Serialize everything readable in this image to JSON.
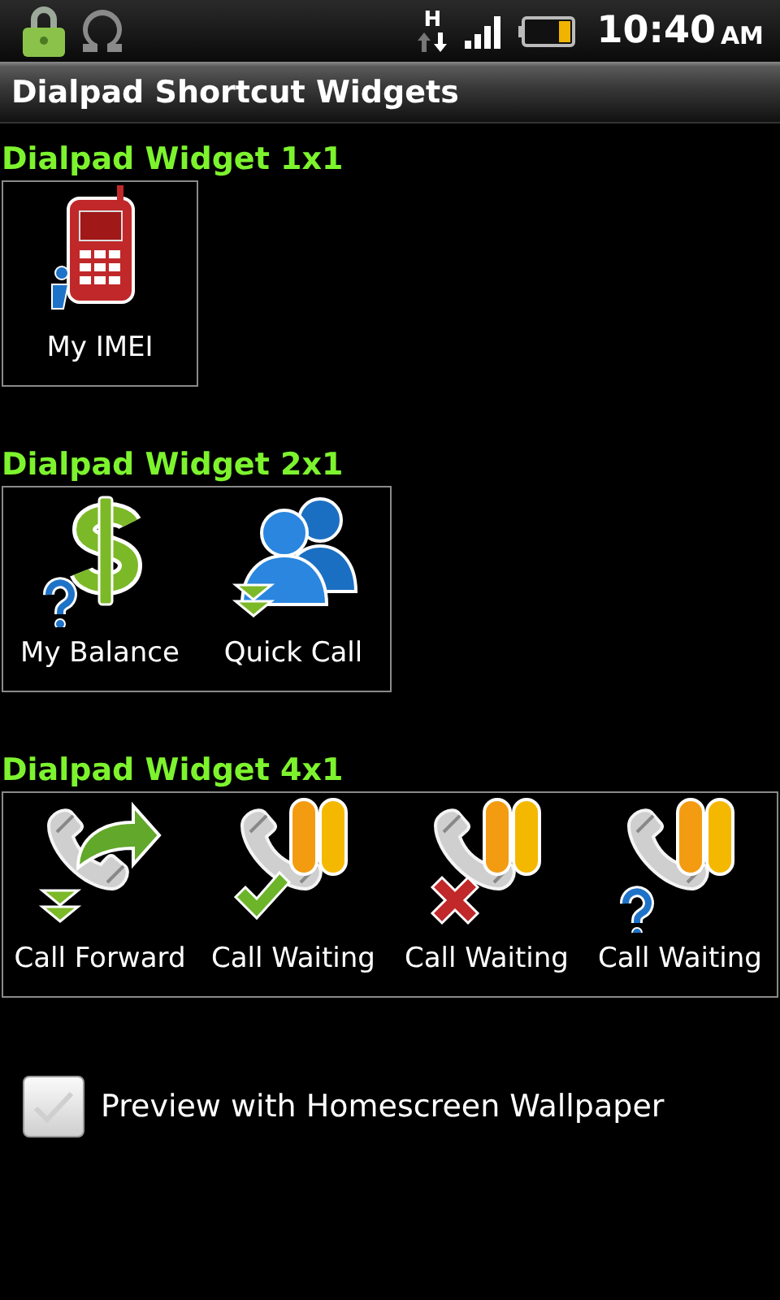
{
  "status_bar": {
    "network": "H",
    "time": "10:40",
    "meridiem": "AM"
  },
  "title": "Dialpad Shortcut Widgets",
  "sections": [
    {
      "heading": "Dialpad Widget 1x1",
      "widgets": [
        {
          "label": "My IMEI",
          "kind": "imei"
        }
      ]
    },
    {
      "heading": "Dialpad Widget 2x1",
      "widgets": [
        {
          "label": "My Balance",
          "kind": "balance"
        },
        {
          "label": "Quick Call",
          "kind": "quickcall"
        }
      ]
    },
    {
      "heading": "Dialpad Widget 4x1",
      "widgets": [
        {
          "label": "Call Forward",
          "kind": "forward"
        },
        {
          "label": "Call Waiting",
          "kind": "waiting-on"
        },
        {
          "label": "Call Waiting",
          "kind": "waiting-off"
        },
        {
          "label": "Call Waiting",
          "kind": "waiting-query"
        }
      ]
    }
  ],
  "preview": {
    "label": "Preview with Homescreen Wallpaper",
    "checked": false
  }
}
